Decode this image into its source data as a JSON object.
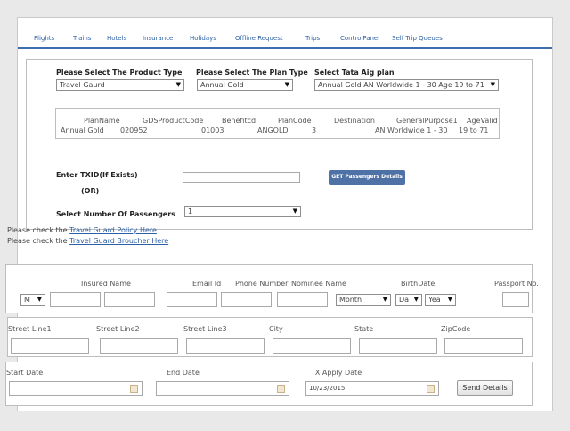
{
  "nav": [
    "Flights",
    "Trains",
    "Hotels",
    "Insurance",
    "Holidays",
    "Offline Request",
    "Trips",
    "ControlPanel",
    "Self Trip Queues"
  ],
  "product": {
    "product_label": "Please Select The Product Type",
    "product_value": "Travel Gaurd",
    "plan_type_label": "Please Select The Plan Type",
    "plan_type_value": "Annual Gold",
    "tata_label": "Select Tata Aig plan",
    "tata_value": "Annual Gold AN Worldwide 1 - 30 Age 19 to 71"
  },
  "plan_table": {
    "headers": [
      "PlanName",
      "GDSProductCode",
      "Benefitcd",
      "PlanCode",
      "Destination",
      "GeneralPurpose1",
      "AgeValid"
    ],
    "row": [
      "Annual Gold",
      "020952",
      "01003",
      "ANGOLD",
      "3",
      "AN Worldwide 1 - 30",
      "19 to 71"
    ]
  },
  "txid": {
    "label": "Enter TXID(If Exists)",
    "or": "(OR)",
    "button": "GET Passengers Details"
  },
  "passengers": {
    "label": "Select Number Of Passengers",
    "value": "1"
  },
  "policy": {
    "line1_prefix": "Please check the ",
    "line1_link": "Travel Guard Policy Here ",
    "line2_prefix": "Please check the ",
    "line2_link": "Travel Guard Broucher Here"
  },
  "insured": {
    "headers": {
      "insured_name": "Insured Name",
      "email": "Email Id",
      "phone": "Phone Number",
      "nominee": "Nominee Name",
      "birth": "BirthDate",
      "passport": "Passport No."
    },
    "title_value": "M",
    "month_value": "Month",
    "day_value": "Da",
    "year_value": "Yea"
  },
  "address": {
    "headers": [
      "Street Line1",
      "Street Line2",
      "Street Line3",
      "City",
      "State",
      "ZipCode"
    ]
  },
  "dates": {
    "start_label": "Start Date",
    "end_label": "End Date",
    "apply_label": "TX Apply Date",
    "apply_value": "10/23/2015",
    "send_button": "Send Details"
  },
  "icons": {
    "dropdown": "chevron-down-icon",
    "calendar": "calendar-icon"
  },
  "colors": {
    "nav_text": "#2b5fa6",
    "nav_rule": "#3f6caf",
    "button_blue": "#4f72a6"
  }
}
